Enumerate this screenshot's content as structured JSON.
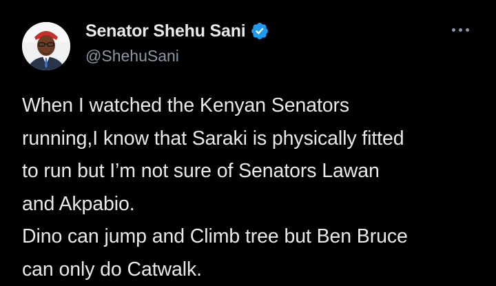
{
  "author": {
    "display_name": "Senator Shehu Sani",
    "handle": "@ShehuSani",
    "verified": true,
    "avatar_icon": "profile-photo-avatar"
  },
  "tweet": {
    "lines": [
      "When I watched the Kenyan Senators",
      "running,I know that Saraki is physically fitted",
      "to run but I’m not sure of Senators Lawan",
      "and Akpabio.",
      "Dino can jump and Climb tree but Ben Bruce",
      "can only do Catwalk."
    ]
  },
  "icons": {
    "verified": "verified-badge-icon",
    "more": "more-options-icon"
  },
  "colors": {
    "background": "#000000",
    "text": "#e7e9ea",
    "secondary_text": "#8b98a5",
    "verified_blue": "#1d9bf0"
  }
}
